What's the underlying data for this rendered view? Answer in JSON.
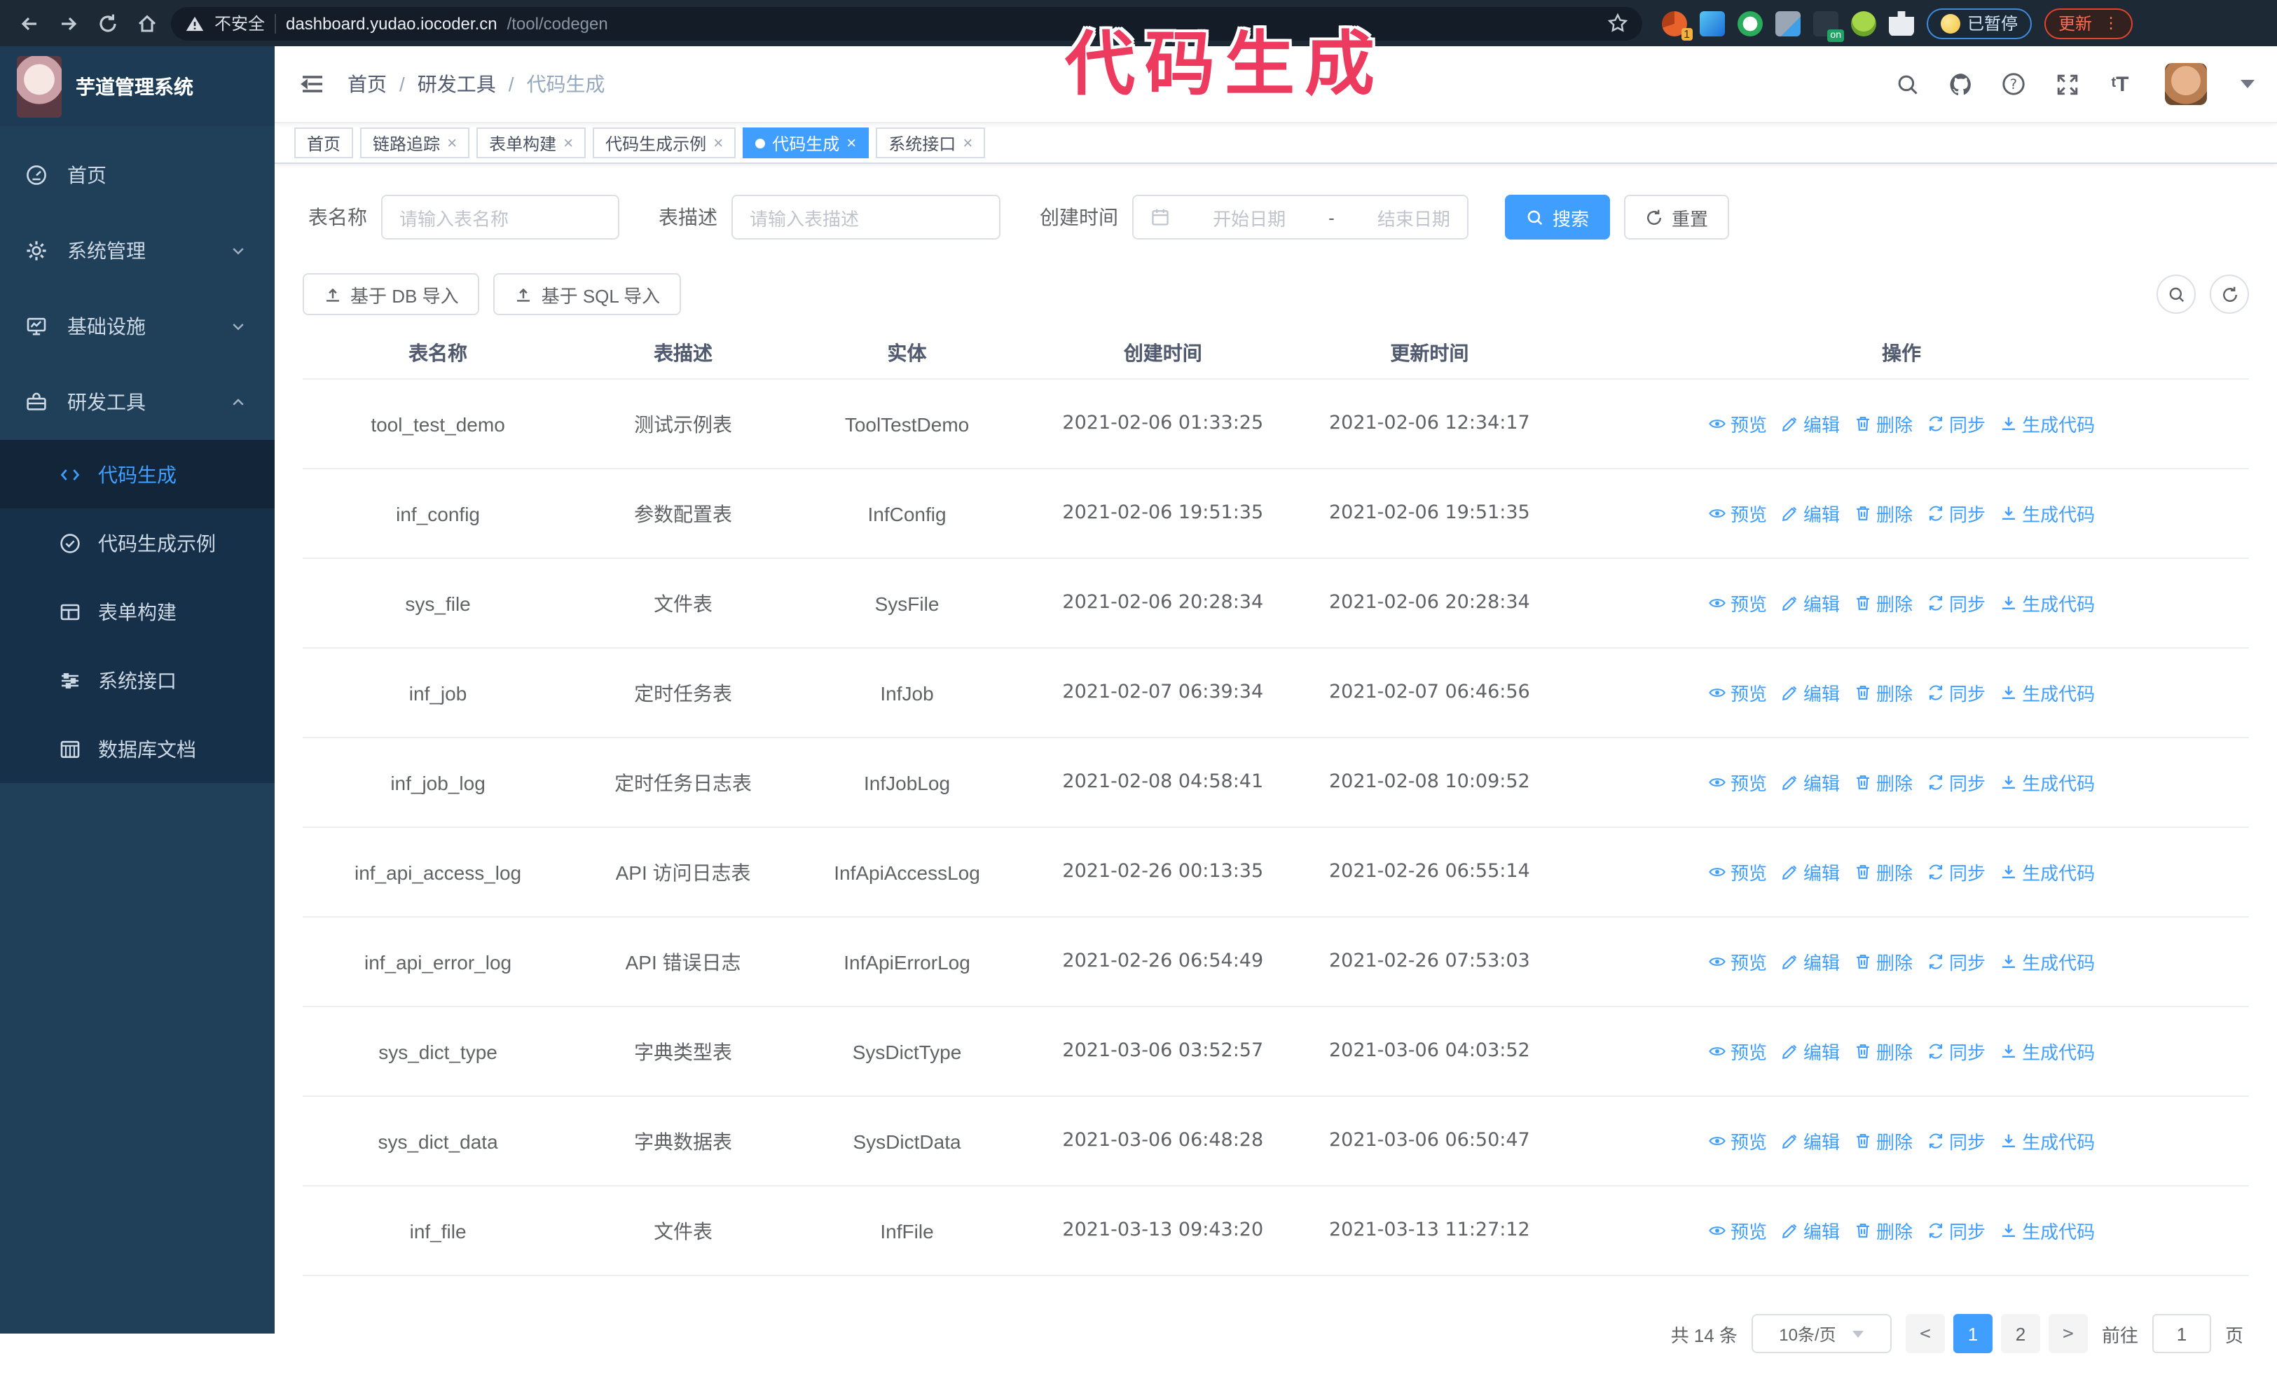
{
  "browser": {
    "security_label": "不安全",
    "url_host": "dashboard.yudao.iocoder.cn",
    "url_path": "/tool/codegen",
    "extension_badge": "1",
    "extension_on_badge": "on",
    "paused_chip_label": "已暂停",
    "update_chip_label": "更新"
  },
  "annotation": {
    "text": "代码生成",
    "color": "#ed3a5f"
  },
  "sidebar": {
    "title": "芋道管理系统",
    "items": [
      {
        "label": "首页"
      },
      {
        "label": "系统管理"
      },
      {
        "label": "基础设施"
      },
      {
        "label": "研发工具"
      }
    ],
    "submenu": [
      {
        "label": "代码生成"
      },
      {
        "label": "代码生成示例"
      },
      {
        "label": "表单构建"
      },
      {
        "label": "系统接口"
      },
      {
        "label": "数据库文档"
      }
    ]
  },
  "header": {
    "breadcrumb": [
      "首页",
      "研发工具",
      "代码生成"
    ]
  },
  "tabs": [
    {
      "label": "首页"
    },
    {
      "label": "链路追踪"
    },
    {
      "label": "表单构建"
    },
    {
      "label": "代码生成示例"
    },
    {
      "label": "代码生成"
    },
    {
      "label": "系统接口"
    }
  ],
  "filters": {
    "table_name_label": "表名称",
    "table_name_placeholder": "请输入表名称",
    "table_desc_label": "表描述",
    "table_desc_placeholder": "请输入表描述",
    "create_time_label": "创建时间",
    "date_start_placeholder": "开始日期",
    "date_separator": "-",
    "date_end_placeholder": "结束日期",
    "search_label": "搜索",
    "reset_label": "重置"
  },
  "toolbar": {
    "import_db_label": "基于 DB 导入",
    "import_sql_label": "基于 SQL 导入"
  },
  "table": {
    "columns": [
      "表名称",
      "表描述",
      "实体",
      "创建时间",
      "更新时间",
      "操作"
    ],
    "actions": [
      "预览",
      "编辑",
      "删除",
      "同步",
      "生成代码"
    ],
    "rows": [
      {
        "name": "tool_test_demo",
        "desc": "测试示例表",
        "entity": "ToolTestDemo",
        "create_time": "2021-02-06 01:33:25",
        "update_time": "2021-02-06 12:34:17"
      },
      {
        "name": "inf_config",
        "desc": "参数配置表",
        "entity": "InfConfig",
        "create_time": "2021-02-06 19:51:35",
        "update_time": "2021-02-06 19:51:35"
      },
      {
        "name": "sys_file",
        "desc": "文件表",
        "entity": "SysFile",
        "create_time": "2021-02-06 20:28:34",
        "update_time": "2021-02-06 20:28:34"
      },
      {
        "name": "inf_job",
        "desc": "定时任务表",
        "entity": "InfJob",
        "create_time": "2021-02-07 06:39:34",
        "update_time": "2021-02-07 06:46:56"
      },
      {
        "name": "inf_job_log",
        "desc": "定时任务日志表",
        "entity": "InfJobLog",
        "create_time": "2021-02-08 04:58:41",
        "update_time": "2021-02-08 10:09:52"
      },
      {
        "name": "inf_api_access_log",
        "desc": "API 访问日志表",
        "entity": "InfApiAccessLog",
        "create_time": "2021-02-26 00:13:35",
        "update_time": "2021-02-26 06:55:14"
      },
      {
        "name": "inf_api_error_log",
        "desc": "API 错误日志",
        "entity": "InfApiErrorLog",
        "create_time": "2021-02-26 06:54:49",
        "update_time": "2021-02-26 07:53:03"
      },
      {
        "name": "sys_dict_type",
        "desc": "字典类型表",
        "entity": "SysDictType",
        "create_time": "2021-03-06 03:52:57",
        "update_time": "2021-03-06 04:03:52"
      },
      {
        "name": "sys_dict_data",
        "desc": "字典数据表",
        "entity": "SysDictData",
        "create_time": "2021-03-06 06:48:28",
        "update_time": "2021-03-06 06:50:47"
      },
      {
        "name": "inf_file",
        "desc": "文件表",
        "entity": "InfFile",
        "create_time": "2021-03-13 09:43:20",
        "update_time": "2021-03-13 11:27:12"
      }
    ]
  },
  "pagination": {
    "total_label": "共 14 条",
    "page_size_label": "10条/页",
    "pages": [
      "1",
      "2"
    ],
    "goto_label": "前往",
    "goto_value": "1",
    "page_unit_label": "页"
  }
}
